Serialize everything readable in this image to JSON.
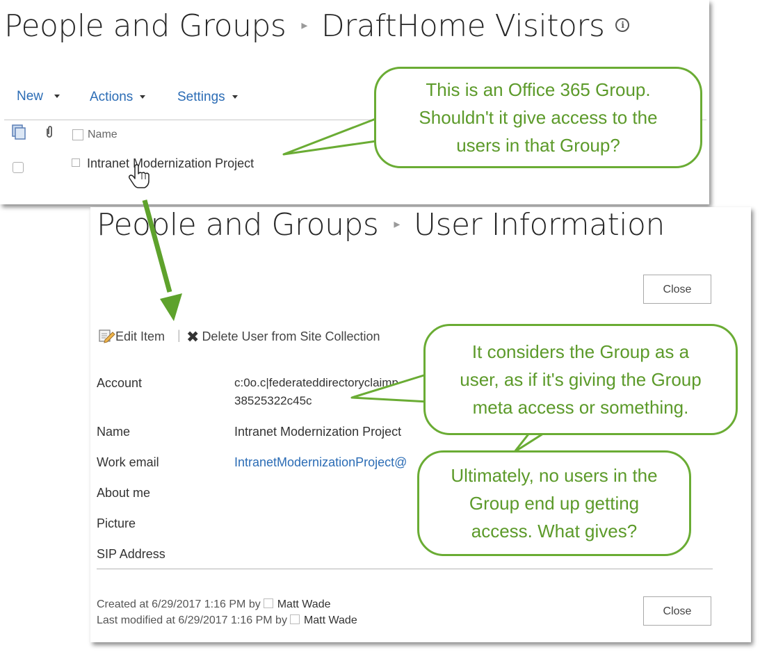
{
  "top_panel": {
    "breadcrumb_root": "People and Groups",
    "breadcrumb_current": "DraftHome Visitors",
    "toolbar": {
      "new_label": "New",
      "actions_label": "Actions",
      "settings_label": "Settings"
    },
    "list": {
      "column_name_header": "Name",
      "rows": [
        {
          "name": "Intranet Modernization Project"
        }
      ]
    }
  },
  "bottom_panel": {
    "breadcrumb_root": "People and Groups",
    "breadcrumb_current": "User Information",
    "close_label": "Close",
    "commands": {
      "edit_label": "Edit Item",
      "delete_label": "Delete User from Site Collection"
    },
    "fields": {
      "account_label": "Account",
      "account_value_line1": "c:0o.c|federateddirectoryclaimp",
      "account_value_line2": "38525322c45c",
      "name_label": "Name",
      "name_value": "Intranet Modernization Project",
      "work_email_label": "Work email",
      "work_email_value": "IntranetModernizationProject@",
      "about_me_label": "About me",
      "picture_label": "Picture",
      "sip_label": "SIP Address"
    },
    "footer": {
      "created_prefix": "Created at 6/29/2017 1:16 PM by",
      "created_by": "Matt Wade",
      "modified_prefix": "Last modified at 6/29/2017 1:16 PM by",
      "modified_by": "Matt Wade"
    }
  },
  "callouts": {
    "c1_line1": "This is an Office 365 Group.",
    "c1_line2": "Shouldn't it give access to the",
    "c1_line3": "users in that Group?",
    "c2_line1": "It considers the Group as a",
    "c2_line2": "user, as if it's giving the Group",
    "c2_line3": "meta access or something.",
    "c3_line1": "Ultimately, no users in the",
    "c3_line2": "Group end up getting",
    "c3_line3": "access. What gives?"
  },
  "colors": {
    "link": "#2b6cb5",
    "callout_green": "#6aac34",
    "callout_text": "#5c9a2a"
  }
}
